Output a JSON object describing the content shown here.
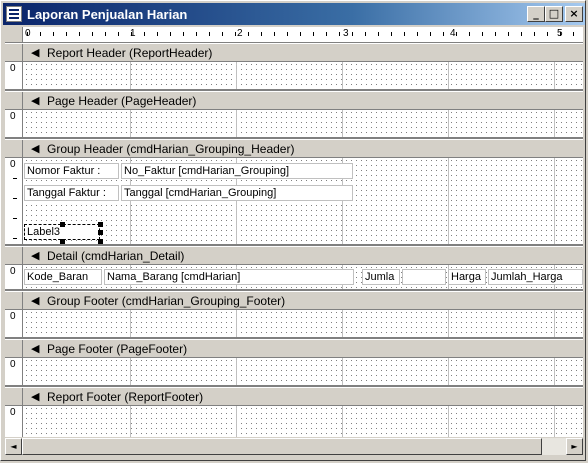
{
  "window": {
    "title": "Laporan Penjualan Harian"
  },
  "title_buttons": {
    "minimize": "_",
    "maximize": "□",
    "close": "×"
  },
  "ruler": {
    "labels": [
      "0",
      "1",
      "2",
      "3",
      "4",
      "5"
    ]
  },
  "sections": [
    {
      "label": "Report Header (ReportHeader)"
    },
    {
      "label": "Page Header (PageHeader)"
    },
    {
      "label": "Group Header (cmdHarian_Grouping_Header)"
    },
    {
      "label": "Detail (cmdHarian_Detail)"
    },
    {
      "label": "Group Footer (cmdHarian_Grouping_Footer)"
    },
    {
      "label": "Page Footer (PageFooter)"
    },
    {
      "label": "Report Footer (ReportFooter)"
    }
  ],
  "vruler_zero": "0",
  "group_header_controls": {
    "nomor_label": "Nomor Faktur :",
    "nomor_field": "No_Faktur [cmdHarian_Grouping]",
    "tanggal_label": "Tanggal Faktur :",
    "tanggal_field": "Tanggal [cmdHarian_Grouping]",
    "label3": "Label3"
  },
  "detail_controls": {
    "kode": "Kode_Baran",
    "nama": "Nama_Barang [cmdHarian]",
    "jumlah": "Jumla",
    "harga": "Harga",
    "jumlah_harga": "Jumlah_Harga"
  },
  "scroll_arrows": {
    "left": "◄",
    "right": "►"
  }
}
